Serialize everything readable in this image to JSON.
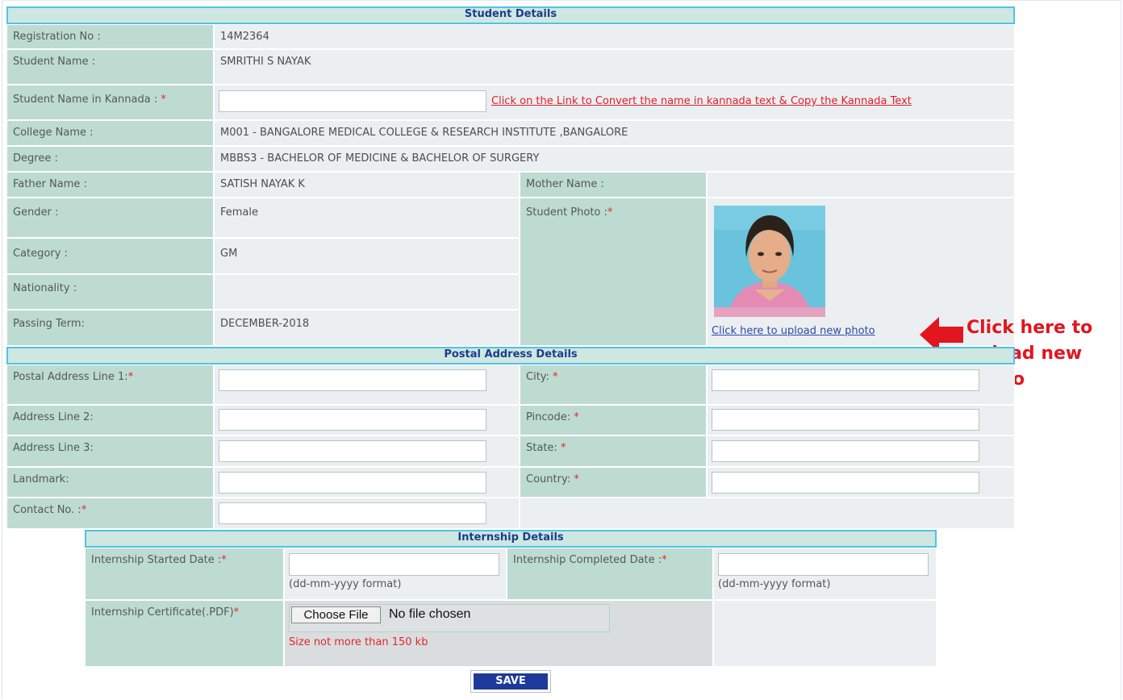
{
  "student": {
    "header": "Student Details",
    "registration_label": "Registration No :",
    "registration_value": "14M2364",
    "name_label": "Student Name :",
    "name_value": "SMRITHI S NAYAK",
    "kannada_label": "Student Name in Kannada :",
    "kannada_value": "",
    "kannada_link": "Click on the Link to Convert the name in kannada text & Copy the Kannada Text",
    "college_label": "College Name :",
    "college_value": "M001 - BANGALORE MEDICAL COLLEGE & RESEARCH INSTITUTE ,BANGALORE",
    "degree_label": "Degree :",
    "degree_value": "MBBS3 - BACHELOR OF MEDICINE & BACHELOR OF SURGERY",
    "father_label": "Father Name :",
    "father_value": "SATISH NAYAK K",
    "mother_label": "Mother Name :",
    "mother_value": "",
    "gender_label": "Gender :",
    "gender_value": "Female",
    "photo_label": "Student Photo :",
    "category_label": "Category :",
    "category_value": "GM",
    "nationality_label": "Nationality :",
    "nationality_value": "",
    "passing_label": "Passing Term:",
    "passing_value": "DECEMBER-2018",
    "upload_link": "Click here to upload new photo"
  },
  "annotation": {
    "line1": "Click here to",
    "line2": "upload new",
    "line3": "photo",
    "color": "#e1161f"
  },
  "postal": {
    "header": "Postal Address Details",
    "line1_label": "Postal Address Line 1:",
    "line2_label": "Address Line 2:",
    "line3_label": "Address Line 3:",
    "landmark_label": "Landmark:",
    "contact_label": "Contact No. :",
    "city_label": "City: ",
    "pincode_label": "Pincode: ",
    "state_label": "State: ",
    "country_label": "Country: "
  },
  "internship": {
    "header": "Internship Details",
    "started_label": "Internship Started Date :",
    "completed_label": "Internship Completed Date :",
    "date_hint": "(dd-mm-yyyy format)",
    "certificate_label": "Internship Certificate(.PDF)",
    "choose_file": "Choose File",
    "no_file": "No file chosen",
    "size_note": "Size not more than 150 kb"
  },
  "save_label": "SAVE",
  "required_mark": "*"
}
